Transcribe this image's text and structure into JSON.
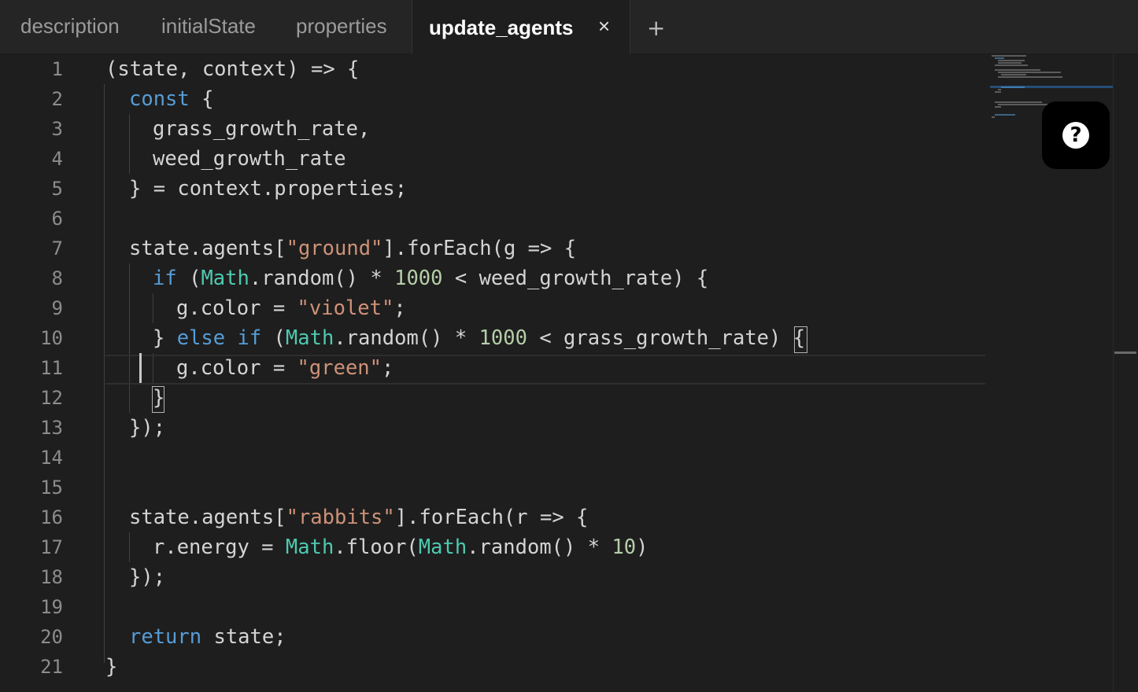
{
  "tabs": [
    {
      "label": "description"
    },
    {
      "label": "initialState"
    },
    {
      "label": "properties"
    },
    {
      "label": "update_agents"
    }
  ],
  "close_symbol": "×",
  "add_symbol": "+",
  "help_symbol": "?",
  "icons": {
    "close": "close-icon",
    "add": "plus-icon",
    "help": "question-mark-icon"
  },
  "colors": {
    "keyword": "#569cd6",
    "string": "#ce9178",
    "number": "#b5cea8",
    "builtin": "#4ec9b0"
  },
  "line_numbers": [
    "1",
    "2",
    "3",
    "4",
    "5",
    "6",
    "7",
    "8",
    "9",
    "10",
    "11",
    "12",
    "13",
    "14",
    "15",
    "16",
    "17",
    "18",
    "19",
    "20",
    "21"
  ],
  "code": {
    "l1": "(state, context) => {",
    "l2_kw": "const",
    "l2_rest": " {",
    "l3": "grass_growth_rate,",
    "l4": "weed_growth_rate",
    "l5": "} = context.properties;",
    "l7_a": "state.agents[",
    "l7_str": "\"ground\"",
    "l7_b": "].forEach(g => {",
    "l8_kw": "if",
    "l8_a": " (",
    "l8_math": "Math",
    "l8_b": ".random() * ",
    "l8_num": "1000",
    "l8_c": " < weed_growth_rate) {",
    "l9_a": "g.color = ",
    "l9_str": "\"violet\"",
    "l9_b": ";",
    "l10_a": "} ",
    "l10_kw": "else if",
    "l10_b": " (",
    "l10_math": "Math",
    "l10_c": ".random() * ",
    "l10_num": "1000",
    "l10_d": " < grass_growth_rate) {",
    "l11_a": "g.color = ",
    "l11_str": "\"green\"",
    "l11_b": ";",
    "l12": "}",
    "l13": "});",
    "l16_a": "state.agents[",
    "l16_str": "\"rabbits\"",
    "l16_b": "].forEach(r => {",
    "l17_a": "r.energy = ",
    "l17_math1": "Math",
    "l17_b": ".floor(",
    "l17_math2": "Math",
    "l17_c": ".random() * ",
    "l17_num": "10",
    "l17_d": ")",
    "l18": "});",
    "l20_kw": "return",
    "l20_rest": " state;",
    "l21": "}"
  }
}
